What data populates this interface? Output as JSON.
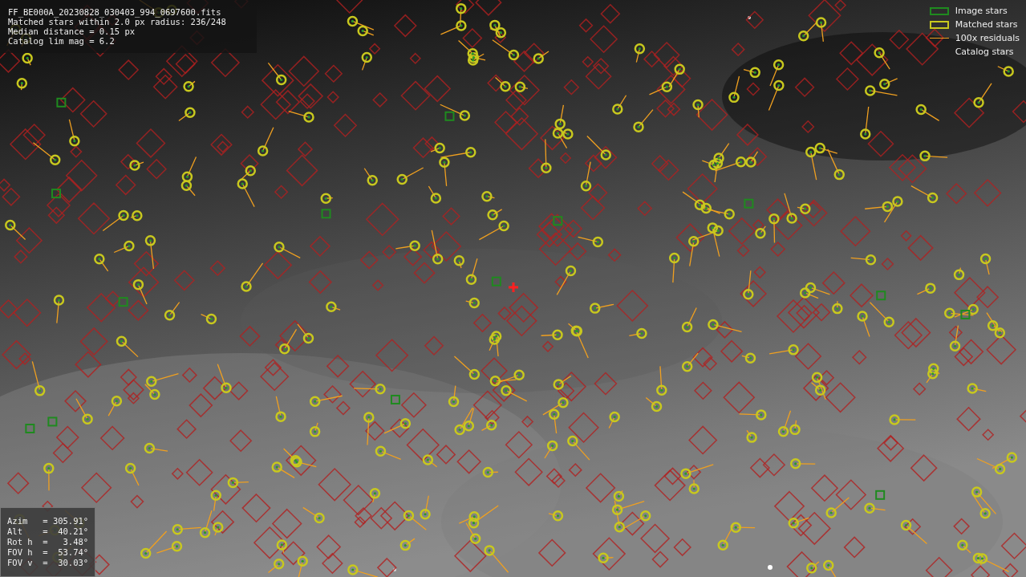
{
  "info": {
    "lines": [
      "FF_BE000A_20230828_030403_994_0697600.fits",
      "Matched stars within 2.0 px radius: 236/248",
      "Median distance = 0.15 px",
      "Catalog lim mag = 6.2"
    ]
  },
  "legend": [
    {
      "kind": "box",
      "color": "#1f8a1f",
      "label": "Image stars"
    },
    {
      "kind": "box",
      "color": "#c8c81e",
      "label": "Matched stars"
    },
    {
      "kind": "line",
      "color": "#f0a020",
      "label": "100x residuals"
    },
    {
      "kind": "blank",
      "label": "Catalog stars"
    }
  ],
  "pointing": {
    "lines": [
      "Azim   = 305.91°",
      "Alt    =  40.21°",
      "Rot h  =   3.48°",
      "FOV h  =  53.74°",
      "FOV v  =  30.03°"
    ]
  }
}
